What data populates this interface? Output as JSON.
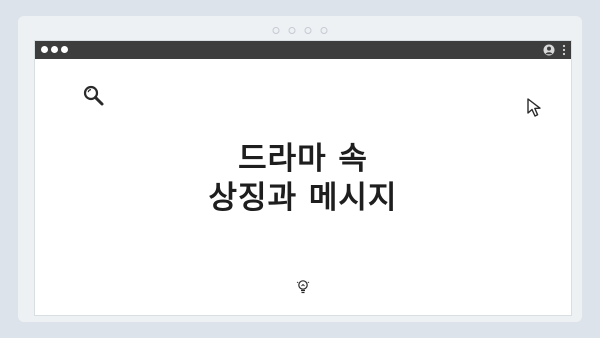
{
  "title": {
    "line1": "드라마 속",
    "line2": "상징과 메시지"
  },
  "icons": {
    "search": "search-icon",
    "cursor": "cursor-icon",
    "user": "user-icon",
    "menu": "more-vertical-icon",
    "bulb": "lightbulb-icon"
  },
  "colors": {
    "background": "#dde3ea",
    "titlebar": "#3d3d3d",
    "window": "#ffffff",
    "text": "#1e1e1e"
  }
}
